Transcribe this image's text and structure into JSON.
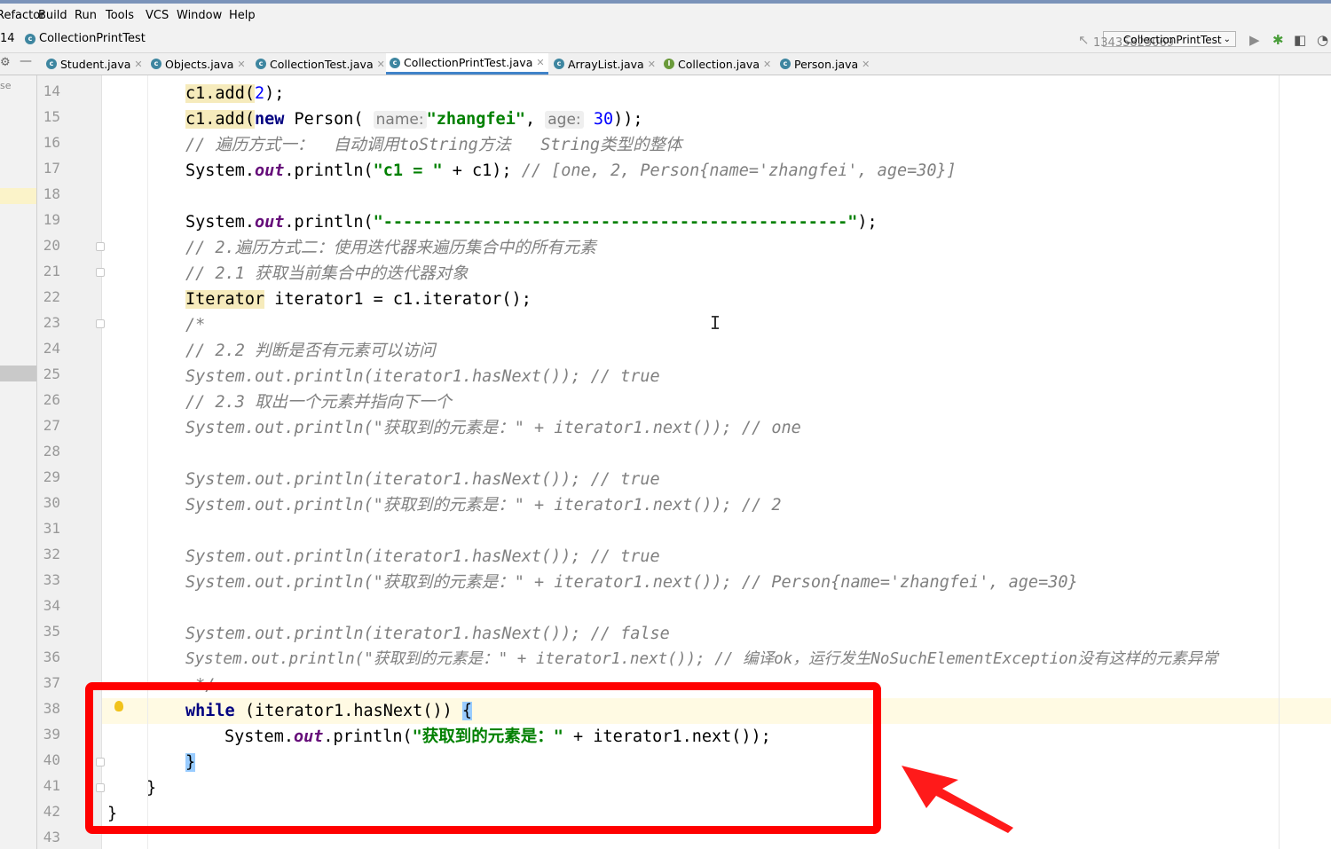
{
  "menu": [
    "Refactor",
    "Build",
    "Run",
    "Tools",
    "VCS",
    "Window",
    "Help"
  ],
  "navbar": {
    "project_suffix": "14",
    "class_name": "CollectionPrintTest"
  },
  "run_config": {
    "name": "CollectionPrintTest",
    "watermark": "13435823069"
  },
  "tabs": [
    {
      "label": "Student.java",
      "icon": "class-icon"
    },
    {
      "label": "Objects.java",
      "icon": "class-icon"
    },
    {
      "label": "CollectionTest.java",
      "icon": "class-icon"
    },
    {
      "label": "CollectionPrintTest.java",
      "icon": "class-icon",
      "active": true
    },
    {
      "label": "ArrayList.java",
      "icon": "class-icon"
    },
    {
      "label": "Collection.java",
      "icon": "interface-icon"
    },
    {
      "label": "Person.java",
      "icon": "class-icon"
    }
  ],
  "left_panel_label": "se",
  "line_numbers": [
    "14",
    "15",
    "16",
    "17",
    "18",
    "19",
    "20",
    "21",
    "22",
    "23",
    "24",
    "25",
    "26",
    "27",
    "28",
    "29",
    "30",
    "31",
    "32",
    "33",
    "34",
    "35",
    "36",
    "37",
    "38",
    "39",
    "40",
    "41",
    "42",
    "43"
  ],
  "code": {
    "l14_a": "c1.add(",
    "l14_num": "2",
    "l14_b": ");",
    "l15_a": "c1.add(",
    "l15_kw": "new",
    "l15_b": " Person(",
    "l15_hint_name": "name:",
    "l15_str": "\"zhangfei\"",
    "l15_c": ", ",
    "l15_hint_age": "age:",
    "l15_num": "30",
    "l15_d": "));",
    "l16_cmt": "// 遍历方式一：  自动调用toString方法   String类型的整体",
    "l17_a": "System.",
    "l17_fld": "out",
    "l17_b": ".println(",
    "l17_str": "\"c1 = \"",
    "l17_c": " + c1); ",
    "l17_cmt": "// [one, 2, Person{name='zhangfei', age=30}]",
    "l19_a": "System.",
    "l19_fld": "out",
    "l19_b": ".println(",
    "l19_str": "\"-----------------------------------------------\"",
    "l19_c": ");",
    "l20_cmt": "// 2.遍历方式二：使用迭代器来遍历集合中的所有元素",
    "l21_cmt": "// 2.1 获取当前集合中的迭代器对象",
    "l22_type": "Iterator",
    "l22_rest": " iterator1 = c1.iterator();",
    "l23_cmt": "/*",
    "l24_cmt": "// 2.2 判断是否有元素可以访问",
    "l25_cmt": "System.out.println(iterator1.hasNext()); // true",
    "l26_cmt": "// 2.3 取出一个元素并指向下一个",
    "l27_cmt": "System.out.println(\"获取到的元素是：\" + iterator1.next()); // one",
    "l29_cmt": "System.out.println(iterator1.hasNext()); // true",
    "l30_cmt": "System.out.println(\"获取到的元素是：\" + iterator1.next()); // 2",
    "l32_cmt": "System.out.println(iterator1.hasNext()); // true",
    "l33_cmt": "System.out.println(\"获取到的元素是：\" + iterator1.next()); // Person{name='zhangfei', age=30}",
    "l35_cmt": "System.out.println(iterator1.hasNext()); // false",
    "l36_cmt": "System.out.println(\"获取到的元素是：\" + iterator1.next()); // 编译ok，运行发生NoSuchElementException没有这样的元素异常",
    "l37_cmt": " */",
    "l38_kw": "while",
    "l38_rest": " (iterator1.hasNext()) ",
    "l38_brace": "{",
    "l39_a": "System.",
    "l39_fld": "out",
    "l39_b": ".println(",
    "l39_str": "\"获取到的元素是：\"",
    "l39_c": " + iterator1.next());",
    "l40_brace": "}",
    "l41": "}",
    "l42": "}"
  },
  "colors": {
    "keyword": "#000080",
    "string": "#008000",
    "comment": "#808080",
    "annotation_box": "#ff0000"
  }
}
